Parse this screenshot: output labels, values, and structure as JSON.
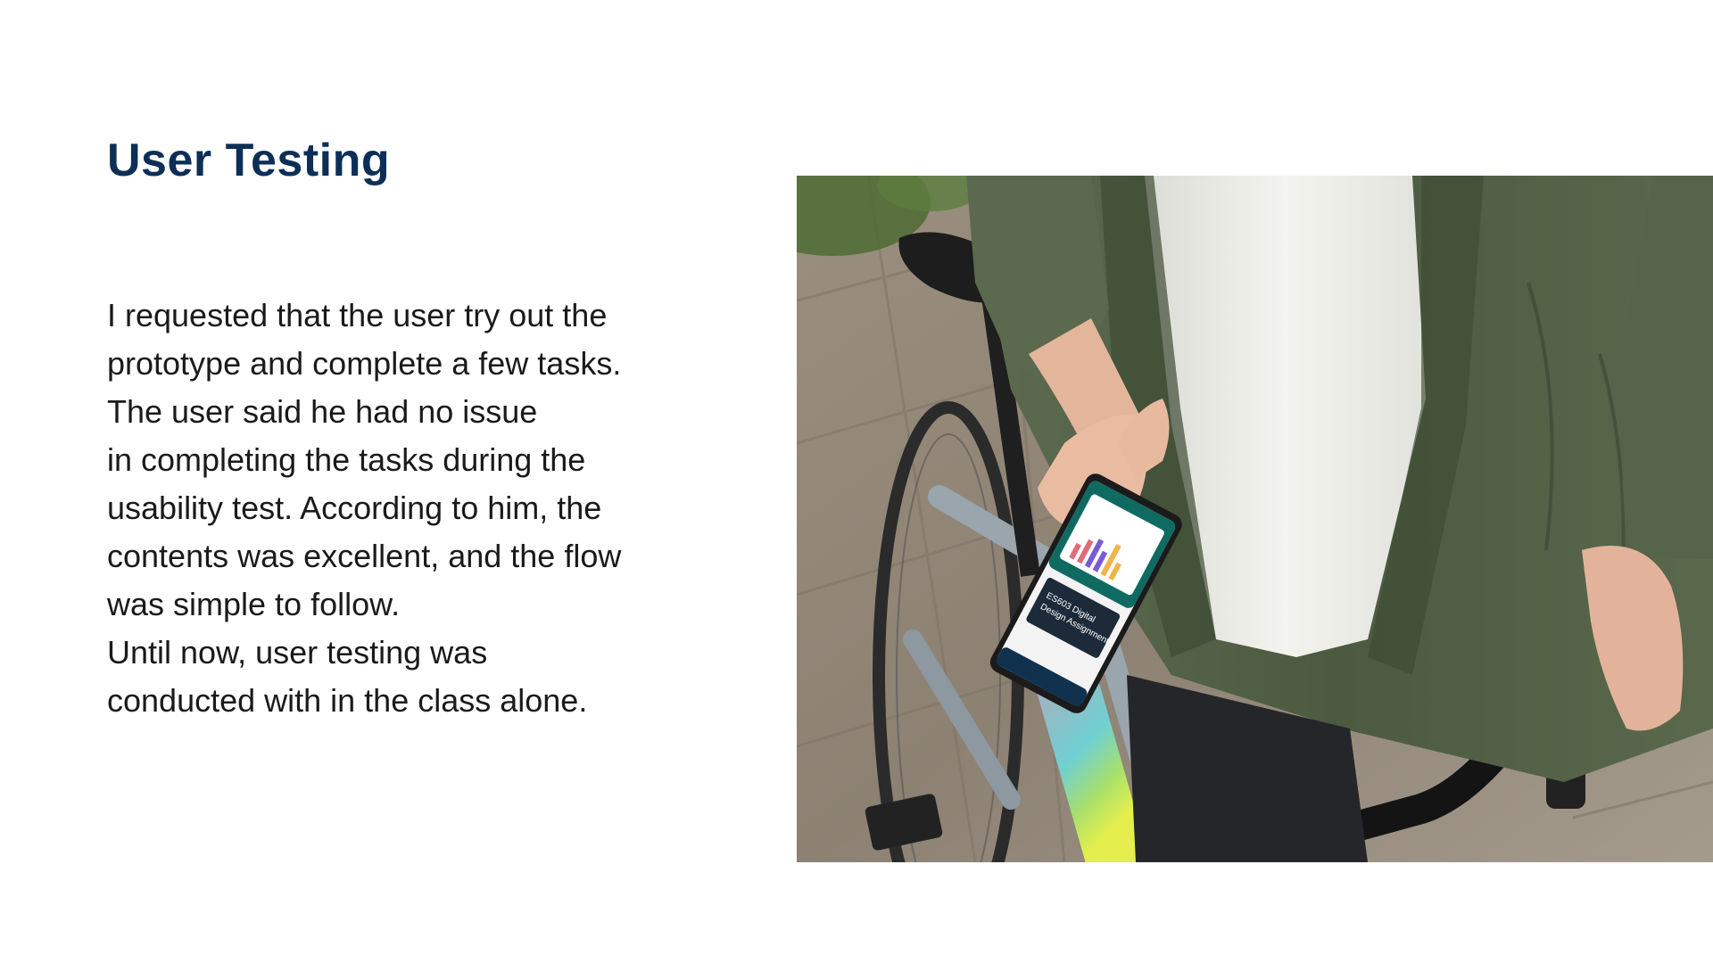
{
  "slide": {
    "title": "User Testing",
    "body_lines": [
      "I requested that the user try out the",
      "prototype and complete a few tasks.",
      "The user said he had no issue",
      "in completing the tasks during the",
      "usability test. According to him, the",
      "contents was excellent, and the flow",
      "was simple to follow.",
      "Until now, user testing was",
      "conducted with in the class alone."
    ]
  },
  "photo": {
    "subject": "person holding smartphone next to bicycle",
    "phone_screen_text": [
      "ES603 Digital",
      "Design Assignment"
    ]
  },
  "colors": {
    "title": "#0d2f57",
    "body": "#1a1a1a",
    "background": "#ffffff",
    "jacket": "#4f5e43",
    "shirt": "#ecece8",
    "phone_accent": "#0f6b62"
  }
}
